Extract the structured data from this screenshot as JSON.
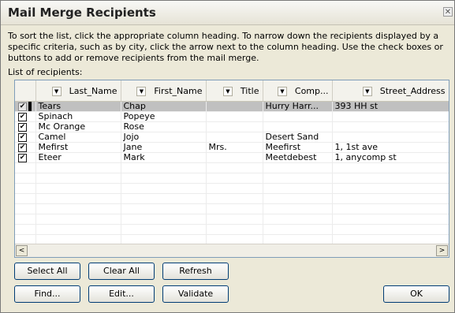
{
  "dialog": {
    "title": "Mail Merge Recipients",
    "close_glyph": "✕",
    "instructions": "To sort the list, click the appropriate column heading.  To narrow down the recipients displayed by a specific criteria, such as by city, click the arrow next to the column heading.  Use the check boxes or buttons to add or remove recipients from the mail merge.",
    "list_label": "List of recipients:"
  },
  "columns": [
    {
      "label": "Last_Name"
    },
    {
      "label": "First_Name"
    },
    {
      "label": "Title"
    },
    {
      "label": "Comp..."
    },
    {
      "label": "Street_Address"
    }
  ],
  "dropdown_glyph": "▼",
  "check_glyph": "✔",
  "rows": [
    {
      "checked": true,
      "selected": true,
      "last": "Tears",
      "first": "Chap",
      "title": "",
      "company": "Hurry Harr...",
      "street": "393 HH st"
    },
    {
      "checked": true,
      "selected": false,
      "last": "Spinach",
      "first": "Popeye",
      "title": "",
      "company": "",
      "street": ""
    },
    {
      "checked": true,
      "selected": false,
      "last": "Mc Orange",
      "first": "Rose",
      "title": "",
      "company": "",
      "street": ""
    },
    {
      "checked": true,
      "selected": false,
      "last": "Camel",
      "first": "Jojo",
      "title": "",
      "company": "Desert Sand",
      "street": ""
    },
    {
      "checked": true,
      "selected": false,
      "last": "Mefirst",
      "first": "Jane",
      "title": "Mrs.",
      "company": "Meefirst",
      "street": "1, 1st ave"
    },
    {
      "checked": true,
      "selected": false,
      "last": "Eteer",
      "first": "Mark",
      "title": "",
      "company": "Meetdebest",
      "street": "1, anycomp st"
    }
  ],
  "scrollbar": {
    "left_glyph": "<",
    "right_glyph": ">"
  },
  "buttons": {
    "select_all": "Select All",
    "clear_all": "Clear All",
    "refresh": "Refresh",
    "find": "Find...",
    "edit": "Edit...",
    "validate": "Validate",
    "ok": "OK"
  },
  "colors": {
    "selected_row": "#c0c0c0",
    "dialog_bg": "#ece9d8",
    "grid_border": "#7f9db9"
  }
}
